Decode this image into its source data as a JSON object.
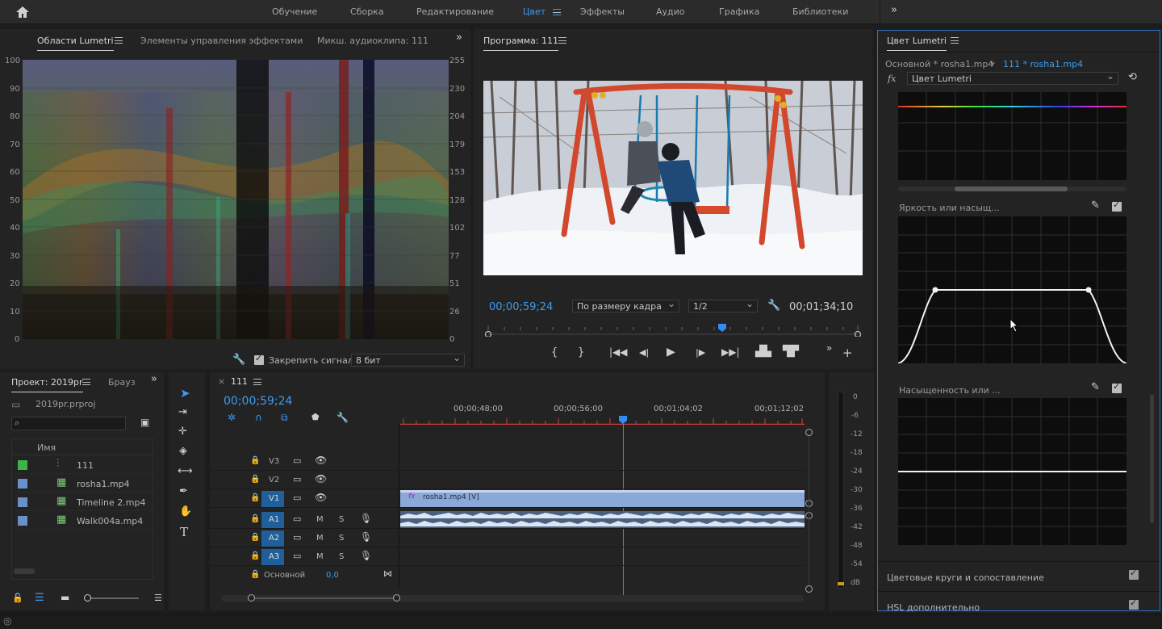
{
  "workspaces": [
    "Обучение",
    "Сборка",
    "Редактирование",
    "Цвет",
    "Эффекты",
    "Аудио",
    "Графика",
    "Библиотеки"
  ],
  "active_workspace": "Цвет",
  "scopes": {
    "tabs": [
      "Области Lumetri",
      "Элементы управления эффектами",
      "Микш. аудиоклипа: 111"
    ],
    "left_scale": [
      "100",
      "90",
      "80",
      "70",
      "60",
      "50",
      "40",
      "30",
      "20",
      "10",
      "0"
    ],
    "right_scale": [
      "255",
      "230",
      "204",
      "179",
      "153",
      "128",
      "102",
      "77",
      "51",
      "26",
      "0"
    ],
    "clamp_label": "Закрепить сигнал",
    "bit_depth": "8 бит"
  },
  "program": {
    "title": "Программа: 111",
    "timecode_current": "00;00;59;24",
    "fit": "По размеру кадра",
    "resolution": "1/2",
    "timecode_duration": "00;01;34;10",
    "playhead_fraction": 0.62
  },
  "lumetri": {
    "title": "Цвет Lumetri",
    "master_clip": "Основной * rosha1.mp4",
    "seq_clip": "111 * rosha1.mp4",
    "effect": "Цвет Lumetri",
    "curve1_label": "Яркость или насыщ...",
    "curve2_label": "Насыщенность или ...",
    "section1": "Цветовые круги и сопоставление",
    "section2": "HSL дополнительно"
  },
  "project": {
    "tabs": [
      "Проект: 2019pr",
      "Брауз"
    ],
    "file": "2019pr.prproj",
    "column_name": "Имя",
    "items": [
      {
        "name": "111",
        "color": "#3fb24a",
        "icon": "sequence-icon"
      },
      {
        "name": "rosha1.mp4",
        "color": "#6a90c8",
        "icon": "clip-icon"
      },
      {
        "name": "Timeline 2.mp4",
        "color": "#6a90c8",
        "icon": "clip-icon"
      },
      {
        "name": "Walk004a.mp4",
        "color": "#6a90c8",
        "icon": "clip-icon"
      }
    ]
  },
  "timeline": {
    "title": "111",
    "timecode": "00;00;59;24",
    "ruler": [
      "00;00;48;00",
      "00;00;56;00",
      "00;01;04;02",
      "00;01;12;02"
    ],
    "video_tracks": [
      "V3",
      "V2",
      "V1"
    ],
    "audio_tracks": [
      "A1",
      "A2",
      "A3"
    ],
    "track_m": "M",
    "track_s": "S",
    "clip_label": "rosha1.mp4 [V]",
    "master_label": "Основной",
    "master_value": "0,0"
  },
  "meter": {
    "scale": [
      "0",
      "-6",
      "-12",
      "-18",
      "-24",
      "-30",
      "-36",
      "-42",
      "-48",
      "-54",
      "dB"
    ]
  }
}
